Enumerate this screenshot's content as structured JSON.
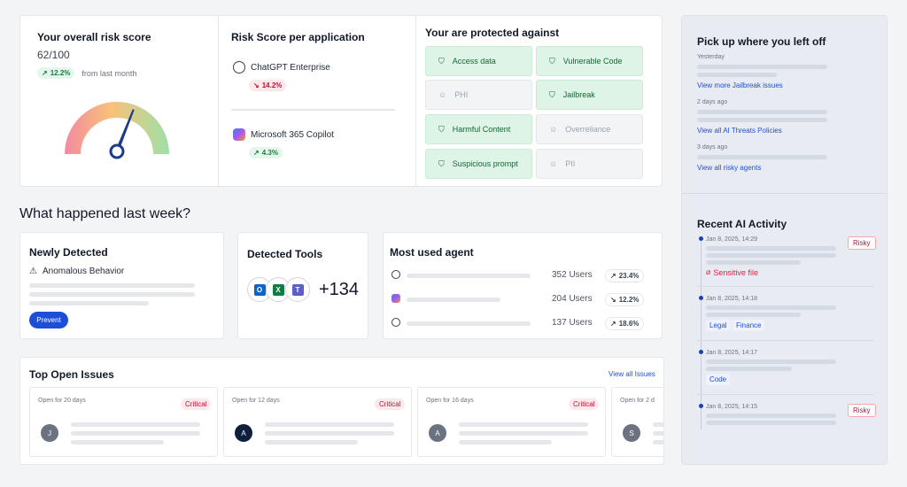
{
  "risk": {
    "title": "Your overall risk score",
    "score": "62/100",
    "change": "12.2%",
    "change_suffix": "from last month",
    "gauge_value": 0.62
  },
  "apps": {
    "title": "Risk Score per application",
    "items": [
      {
        "name": "ChatGPT Enterprise",
        "change": "14.2%",
        "direction": "down"
      },
      {
        "name": "Microsoft 365 Copilot",
        "change": "4.3%",
        "direction": "up"
      }
    ]
  },
  "protected": {
    "title": "Your are protected against",
    "items": [
      {
        "label": "Access data",
        "active": true
      },
      {
        "label": "Vulnerable Code",
        "active": true
      },
      {
        "label": "PHI",
        "active": false
      },
      {
        "label": "Jailbreak",
        "active": true
      },
      {
        "label": "Harmful Content",
        "active": true
      },
      {
        "label": "Overreliance",
        "active": false
      },
      {
        "label": "Suspicious prompt",
        "active": true
      },
      {
        "label": "PII",
        "active": false
      }
    ]
  },
  "week": {
    "heading": "What happened last week?",
    "newly": {
      "title": "Newly Detected",
      "item": "Anomalous Behavior",
      "button": "Prevent"
    },
    "tools": {
      "title": "Detected Tools",
      "count": "+134"
    },
    "agents": {
      "title": "Most used agent",
      "rows": [
        {
          "users": "352 Users",
          "change": "23.4%",
          "direction": "up"
        },
        {
          "users": "204 Users",
          "change": "12.2%",
          "direction": "down"
        },
        {
          "users": "137 Users",
          "change": "18.6%",
          "direction": "up"
        }
      ]
    }
  },
  "issues": {
    "title": "Top Open Issues",
    "view_all": "View all Issues",
    "cards": [
      {
        "open": "Open for 20 days",
        "badge": "Critical",
        "avatar": "J"
      },
      {
        "open": "Open for 12 days",
        "badge": "Critical",
        "avatar": "A"
      },
      {
        "open": "Open for 16 days",
        "badge": "Critical",
        "avatar": "A"
      },
      {
        "open": "Open for 2 d",
        "badge": "",
        "avatar": "S"
      }
    ]
  },
  "pickup": {
    "title": "Pick up where you left off",
    "groups": [
      {
        "when": "Yesterday",
        "link": "View more Jailbreak issues"
      },
      {
        "when": "2 days ago",
        "link": "View all AI Threats Policies"
      },
      {
        "when": "3 days ago",
        "link": "View all risky agents"
      }
    ]
  },
  "activity": {
    "title": "Recent AI Activity",
    "items": [
      {
        "time": "Jan 8, 2025, 14:29",
        "badge": "Risky",
        "extra": "Sensitive file"
      },
      {
        "time": "Jan 8, 2025, 14:18",
        "tags": [
          "Legal",
          "Finance"
        ]
      },
      {
        "time": "Jan 8, 2025, 14:17",
        "tags": [
          "Code"
        ]
      },
      {
        "time": "Jan 8, 2025, 14:15",
        "badge": "Risky"
      }
    ]
  }
}
